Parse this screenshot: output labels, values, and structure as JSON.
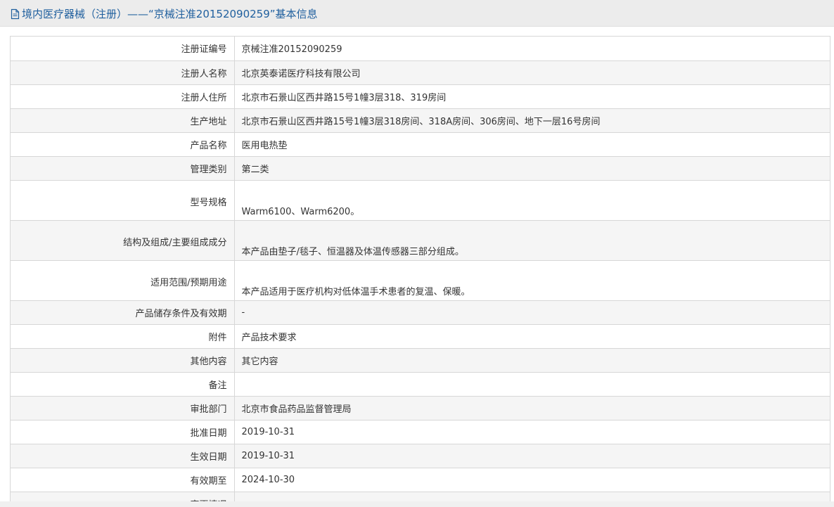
{
  "header": {
    "title": "境内医疗器械（注册）——“京械注准20152090259”基本信息",
    "icon": "document-icon"
  },
  "rows": [
    {
      "label": "注册证编号",
      "value": "京械注准20152090259"
    },
    {
      "label": "注册人名称",
      "value": "北京英泰诺医疗科技有限公司"
    },
    {
      "label": "注册人住所",
      "value": "北京市石景山区西井路15号1幢3层318、319房间"
    },
    {
      "label": "生产地址",
      "value": "北京市石景山区西井路15号1幢3层318房间、318A房间、306房间、地下一层16号房间"
    },
    {
      "label": "产品名称",
      "value": "医用电热垫"
    },
    {
      "label": "管理类别",
      "value": "第二类"
    },
    {
      "label": "型号规格",
      "value": "Warm6100、Warm6200。"
    },
    {
      "label": "结构及组成/主要组成成分",
      "value": "本产品由垫子/毯子、恒温器及体温传感器三部分组成。"
    },
    {
      "label": "适用范围/预期用途",
      "value": "本产品适用于医疗机构对低体温手术患者的复温、保暖。"
    },
    {
      "label": "产品储存条件及有效期",
      "value": "-"
    },
    {
      "label": "附件",
      "value": "产品技术要求"
    },
    {
      "label": "其他内容",
      "value": "其它内容"
    },
    {
      "label": "备注",
      "value": ""
    },
    {
      "label": "审批部门",
      "value": "北京市食品药品监督管理局"
    },
    {
      "label": "批准日期",
      "value": "2019-10-31"
    },
    {
      "label": "生效日期",
      "value": "2019-10-31"
    },
    {
      "label": "有效期至",
      "value": "2024-10-30"
    },
    {
      "label": "变更情况",
      "value": ""
    }
  ],
  "colors": {
    "title_text": "#1f5f9e",
    "header_bg": "#ececec",
    "row_alt_bg": "#f5f5f5",
    "border": "#d7d7d7"
  }
}
